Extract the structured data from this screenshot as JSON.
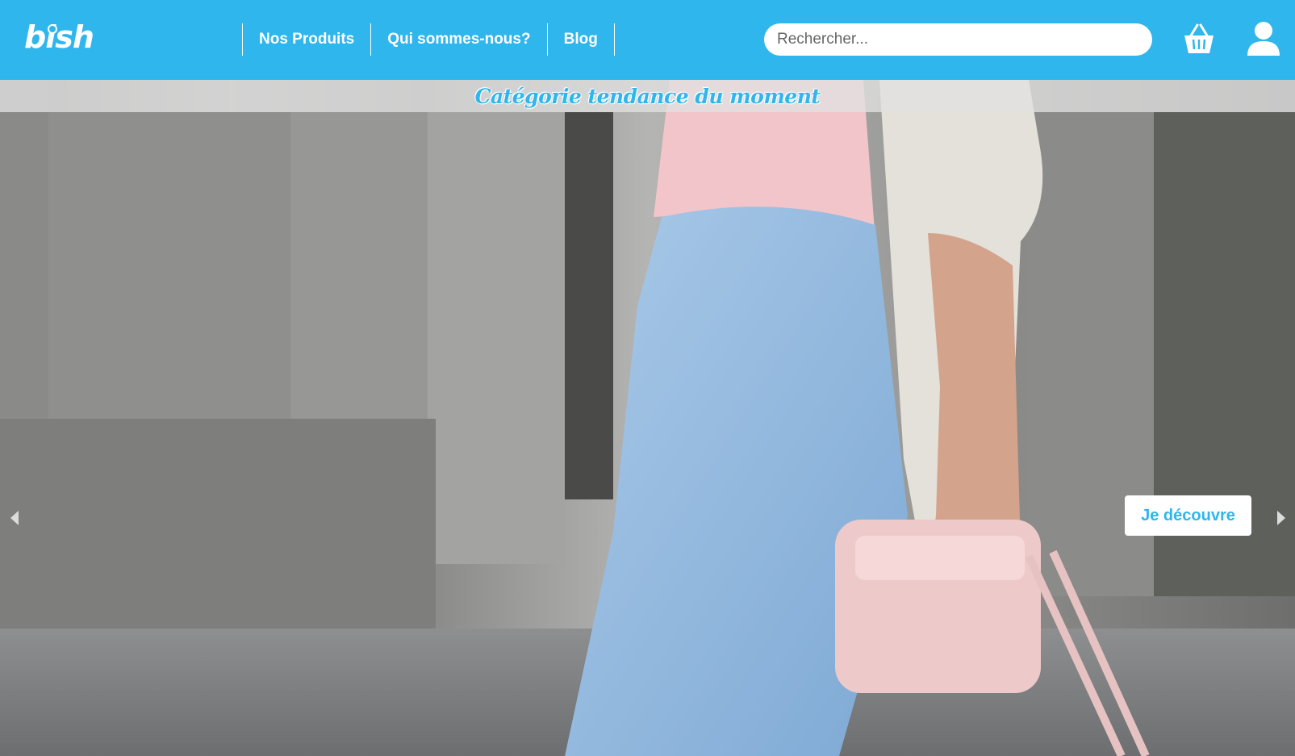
{
  "header": {
    "logo_text": "bish",
    "brand_color": "#2fb6ec",
    "nav": [
      {
        "label": "Nos Produits"
      },
      {
        "label": "Qui sommes-nous?"
      },
      {
        "label": "Blog"
      }
    ],
    "search": {
      "placeholder": "Rechercher...",
      "value": ""
    },
    "icons": [
      "basket-icon",
      "user-icon"
    ]
  },
  "hero": {
    "banner_title": "Catégorie tendance du moment",
    "cta_label": "Je découvre",
    "arrows": [
      "chevron-left-icon",
      "chevron-right-icon"
    ],
    "image_subject": "woman in light blue jeans holding a pink handbag"
  }
}
